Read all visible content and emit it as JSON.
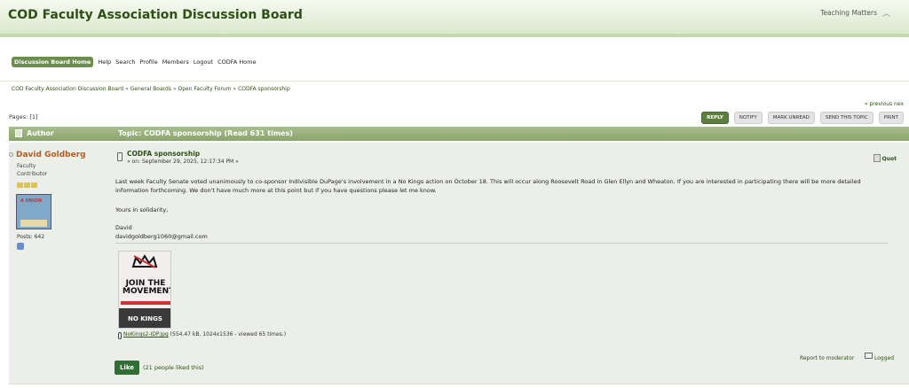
{
  "header": {
    "site_title": "COD Faculty Association Discussion Board",
    "tagline": "Teaching Matters"
  },
  "menu": {
    "items": [
      "Discussion Board Home",
      "Help",
      "Search",
      "Profile",
      "Members",
      "Logout",
      "CODFA Home"
    ]
  },
  "breadcrumb": {
    "items": [
      "COD Faculty Association Discussion Board",
      "General Boards",
      "Open Faculty Forum",
      "CODFA sponsorship"
    ],
    "separator": "»"
  },
  "pagination": {
    "prev_next": "« previous nex",
    "pages_label": "Pages: [1]"
  },
  "actions": {
    "reply": "REPLY",
    "notify": "NOTIFY",
    "mark_unread": "MARK UNREAD",
    "send_topic": "SEND THIS TOPIC",
    "print": "PRINT"
  },
  "table_header": {
    "author": "Author",
    "topic": "Topic: CODFA sponsorship  (Read 631 times)"
  },
  "poster": {
    "name": "David Goldberg",
    "rank1": "Faculty",
    "rank2": "Contributor",
    "posts": "Posts: 642",
    "avatar_text": "A UNION"
  },
  "post": {
    "subject": "CODFA sponsorship",
    "posted": "« on: September 29, 2025, 12:17:34 PM »",
    "quote": "Quot",
    "body": "Last week Faculty Senate voted unanimously to co-sponsor Indivisible DuPage's involvement in a No Kings action on October 18. This will occur along Roosevelt Road in Glen Ellyn and Wheaton. If you are interested in participating there will be more detailed information forthcoming. We don't have much more at this point but if you have questions please let me know.",
    "closing": "Yours in solidarity,",
    "sig_name": "David",
    "sig_email": "davidgoldberg1060@gmail.com"
  },
  "attachment": {
    "poster_headline": "JOIN THE MOVEMENT",
    "poster_footer": "NO KINGS",
    "filename": "NoKings2-IDP.jpg",
    "info": " (554.47 kB, 1024x1536 - viewed 65 times.)"
  },
  "footer": {
    "report": "Report to moderator",
    "logged": "Logged",
    "like": "Like",
    "like_count": "(21 people liked this)"
  }
}
